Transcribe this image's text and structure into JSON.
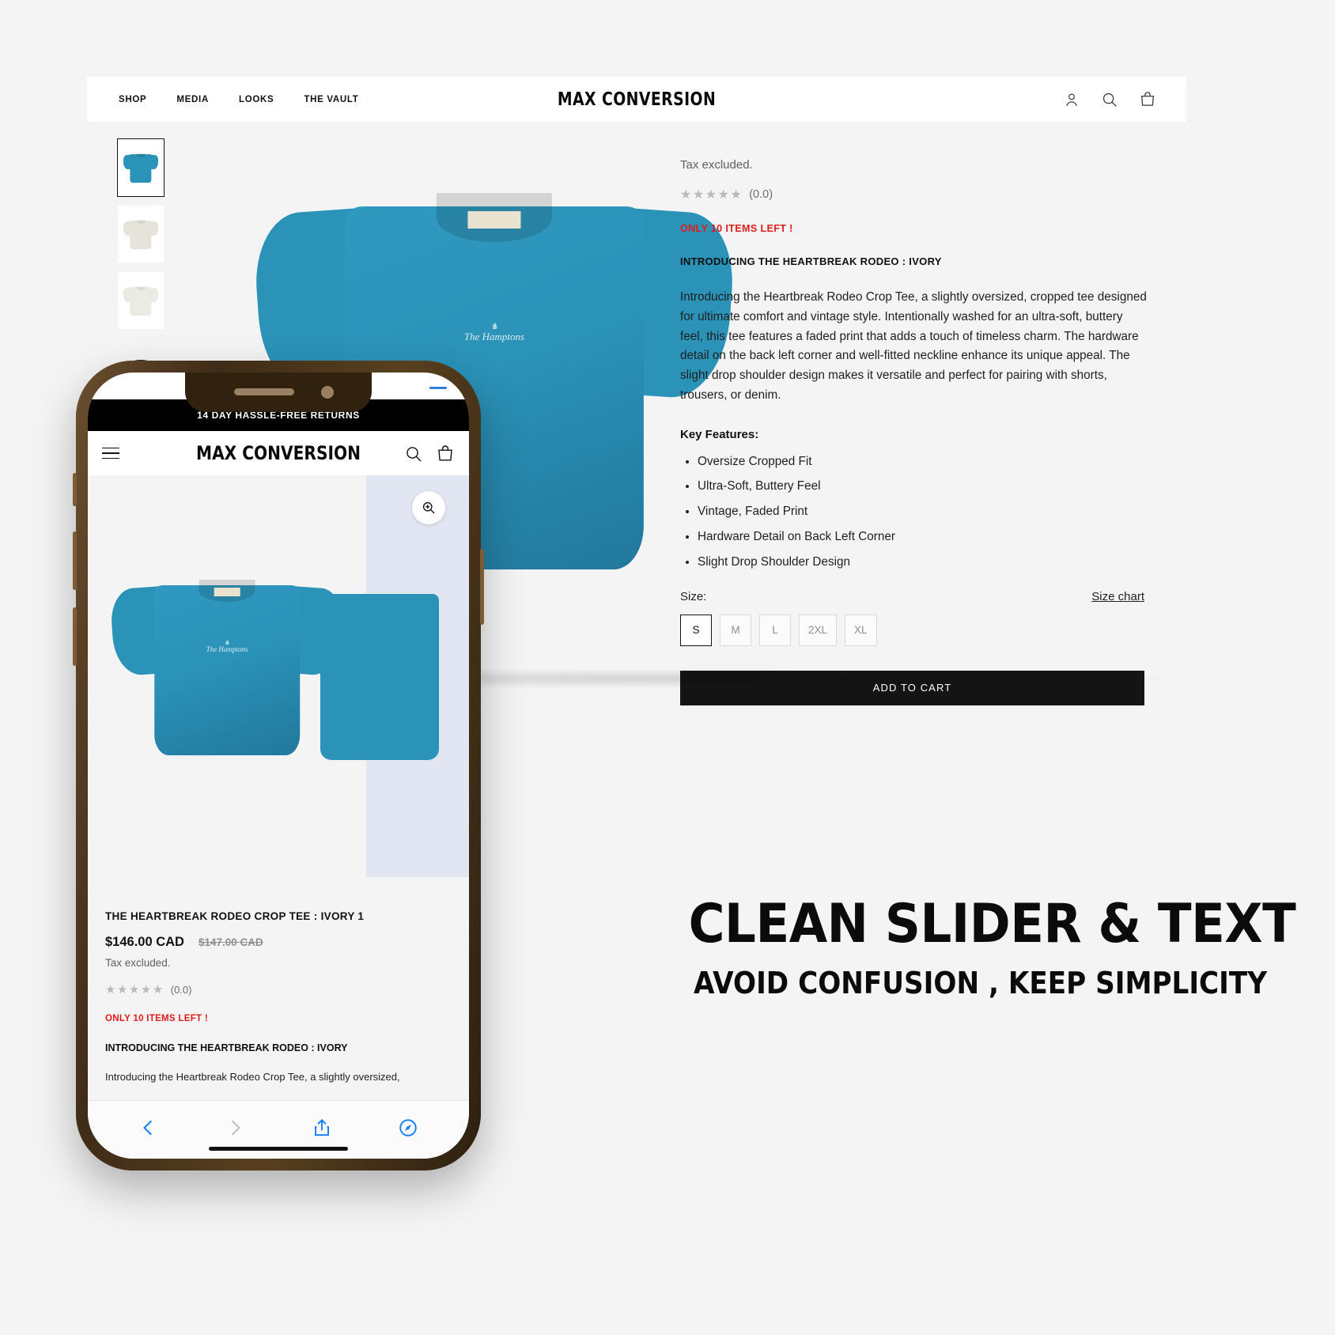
{
  "desktop": {
    "nav": [
      {
        "label": "SHOP"
      },
      {
        "label": "MEDIA"
      },
      {
        "label": "LOOKS"
      },
      {
        "label": "THE VAULT"
      }
    ],
    "brand": "MAX CONVERSION",
    "icons": {
      "account": "account-icon",
      "search": "search-icon",
      "cart": "cart-icon"
    },
    "product": {
      "tax_note": "Tax excluded.",
      "stars": "★★★★★",
      "rating": "(0.0)",
      "stock_warning": "ONLY 10 ITEMS LEFT !",
      "subheading": "INTRODUCING THE HEARTBREAK RODEO : IVORY",
      "description": "Introducing the Heartbreak Rodeo Crop Tee, a slightly oversized, cropped tee designed for ultimate comfort and vintage style. Intentionally washed for an ultra-soft, buttery feel, this tee features a faded print that adds a touch of timeless charm. The hardware detail on the back left corner and well-fitted neckline enhance its unique appeal. The slight drop shoulder design makes it versatile and perfect for pairing with shorts, trousers, or denim.",
      "features_title": "Key Features:",
      "features": [
        "Oversize Cropped Fit",
        "Ultra-Soft, Buttery Feel",
        "Vintage, Faded Print",
        "Hardware Detail on Back Left Corner",
        "Slight Drop Shoulder Design"
      ],
      "size_label": "Size:",
      "size_chart_label": "Size chart",
      "sizes": [
        {
          "label": "S",
          "selected": true
        },
        {
          "label": "M",
          "selected": false
        },
        {
          "label": "L",
          "selected": false
        },
        {
          "label": "2XL",
          "selected": false
        },
        {
          "label": "XL",
          "selected": false
        }
      ],
      "add_to_cart_label": "ADD TO CART",
      "print_line1": "The Hamptons"
    }
  },
  "phone": {
    "announcement": "14 DAY HASSLE-FREE RETURNS",
    "brand": "MAX CONVERSION",
    "product": {
      "title": "THE HEARTBREAK RODEO CROP TEE : IVORY 1",
      "price": "$146.00 CAD",
      "compare_at_price": "$147.00 CAD",
      "tax_note": "Tax excluded.",
      "stars": "★★★★★",
      "rating": "(0.0)",
      "stock_warning": "ONLY 10 ITEMS LEFT !",
      "subheading": "INTRODUCING THE HEARTBREAK RODEO : IVORY",
      "description": "Introducing the Heartbreak Rodeo Crop Tee, a slightly oversized,"
    },
    "icons": {
      "menu": "hamburger-menu-icon",
      "search": "search-icon",
      "cart": "cart-icon",
      "zoom": "zoom-in-icon",
      "back": "chevron-left-icon",
      "forward": "chevron-right-icon",
      "share": "share-icon",
      "compass": "compass-icon"
    }
  },
  "headline": {
    "main": "CLEAN SLIDER & TEXT",
    "sub": "AVOID CONFUSION , KEEP SIMPLICITY"
  },
  "colors": {
    "page_bg": "#f4f4f4",
    "accent_red": "#e01b1b",
    "tee_blue": "#2b92b8",
    "button_dark": "#141414",
    "phone_bezel": "#4a3520"
  }
}
